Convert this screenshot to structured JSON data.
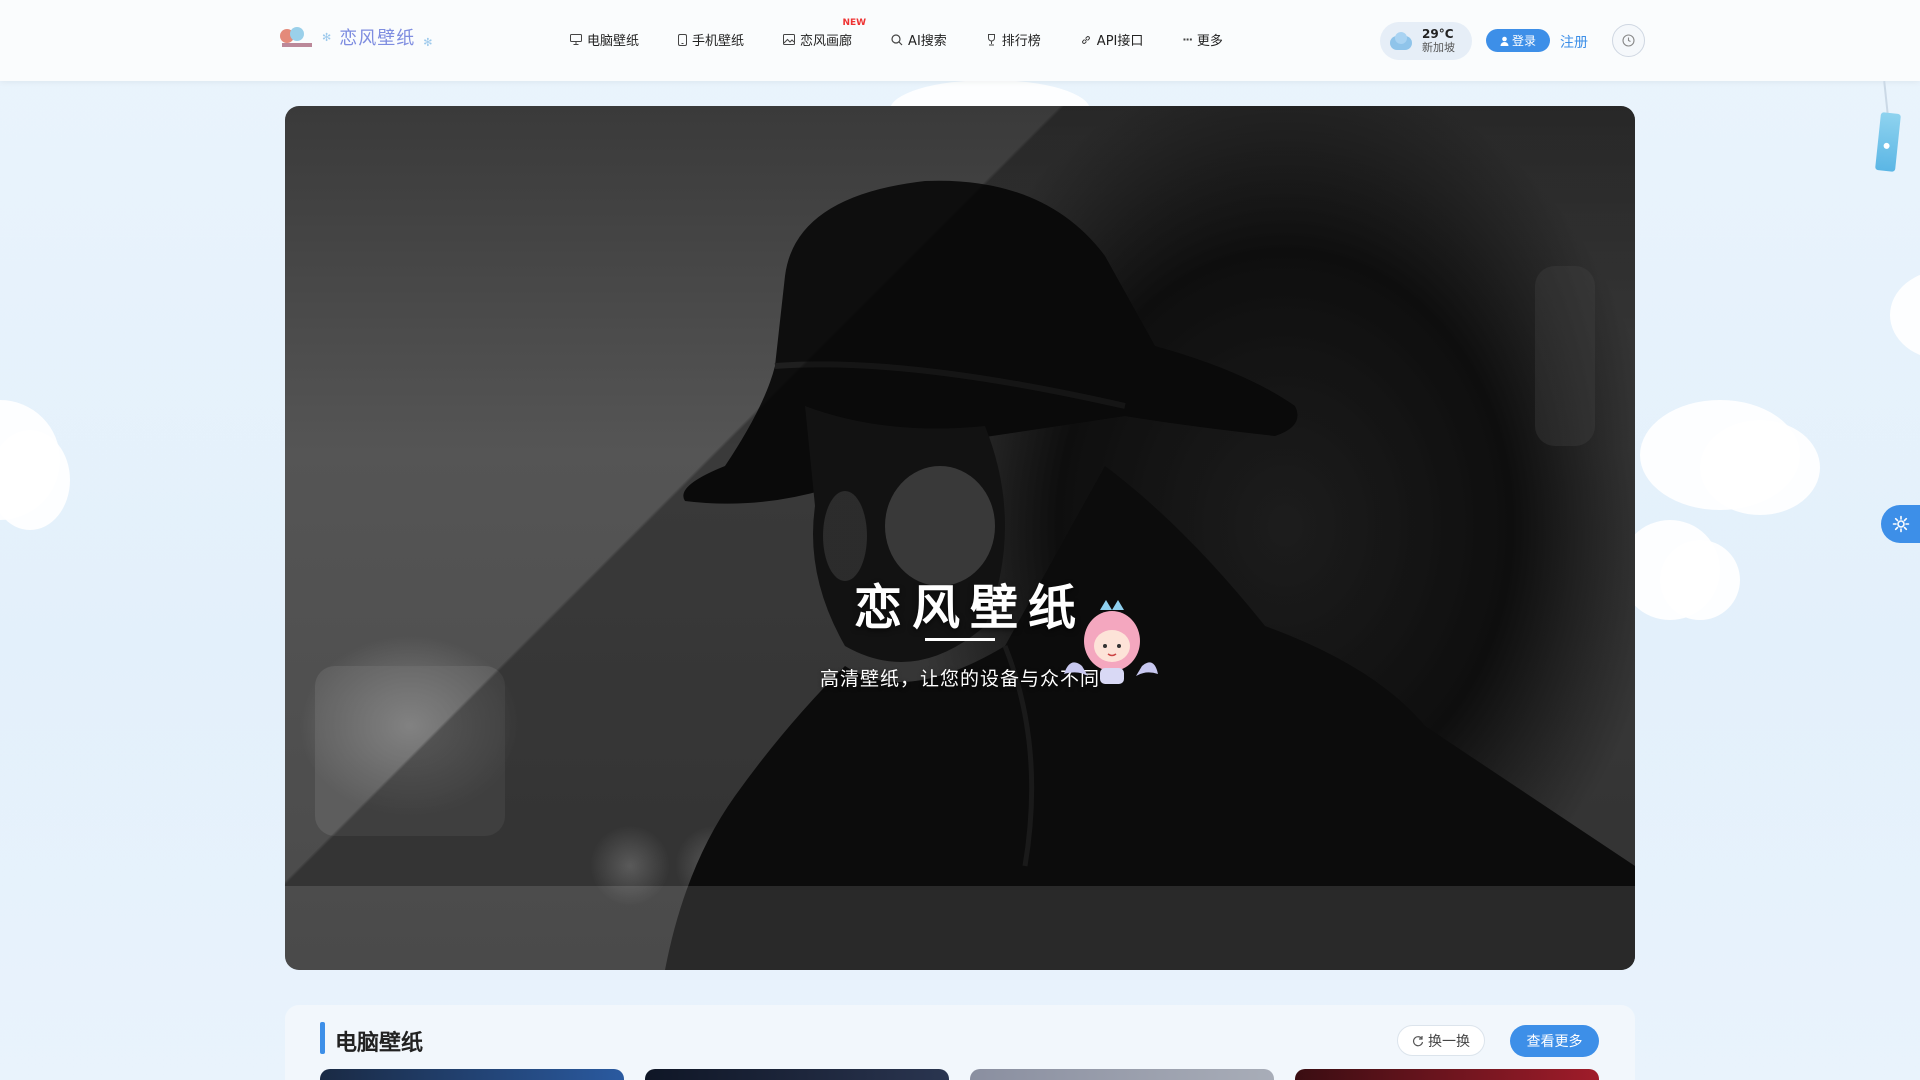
{
  "header": {
    "logo_text": "恋风壁纸",
    "nav": [
      {
        "label": "电脑壁纸",
        "icon": "monitor-icon",
        "badge": ""
      },
      {
        "label": "手机壁纸",
        "icon": "phone-icon",
        "badge": ""
      },
      {
        "label": "恋风画廊",
        "icon": "image-icon",
        "badge": "NEW"
      },
      {
        "label": "AI搜索",
        "icon": "search-icon",
        "badge": ""
      },
      {
        "label": "排行榜",
        "icon": "trophy-icon",
        "badge": ""
      },
      {
        "label": "API接口",
        "icon": "link-icon",
        "badge": ""
      },
      {
        "label": "更多",
        "icon": "more-icon",
        "badge": ""
      }
    ],
    "weather": {
      "temp": "29°C",
      "city": "新加坡"
    },
    "login_label": "登录",
    "register_label": "注册"
  },
  "hero": {
    "title": "恋风壁纸",
    "subtitle": "高清壁纸，让您的设备与众不同"
  },
  "section": {
    "title": "电脑壁纸",
    "refresh_label": "换一换",
    "more_label": "查看更多"
  },
  "colors": {
    "accent": "#3d8fe8",
    "logo": "#7e8de0",
    "badge_new": "#e33333"
  }
}
